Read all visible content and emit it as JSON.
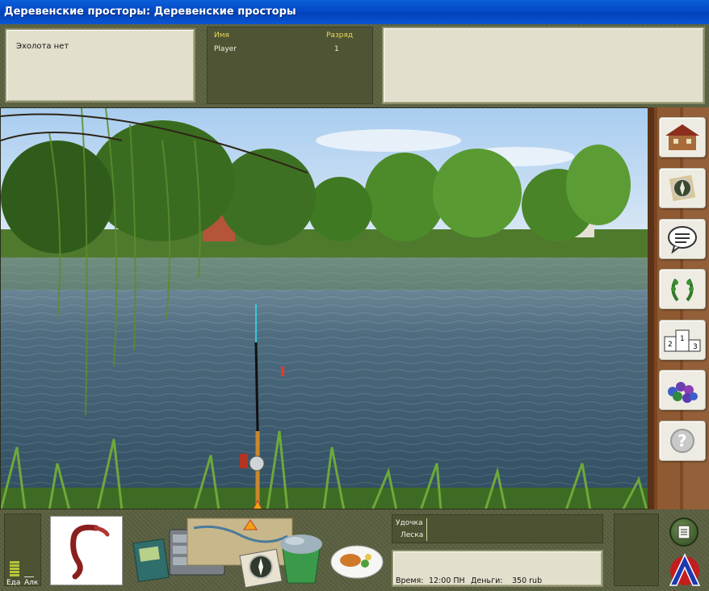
{
  "window": {
    "title": "Деревенские просторы: Деревенские просторы"
  },
  "echo_sounder": {
    "text": "Эхолота нет"
  },
  "players": {
    "headers": {
      "name": "Имя",
      "rank": "Разряд"
    },
    "rows": [
      {
        "name": "Player",
        "rank": "1"
      }
    ]
  },
  "sidebar": {
    "buttons": [
      {
        "icon": "house-icon"
      },
      {
        "icon": "compass-icon"
      },
      {
        "icon": "chat-icon"
      },
      {
        "icon": "laurel-wreath-icon"
      },
      {
        "icon": "podium-icon",
        "labels": [
          "1",
          "2",
          "3"
        ]
      },
      {
        "icon": "grapes-icon"
      },
      {
        "icon": "help-icon",
        "label": "?"
      }
    ]
  },
  "meters": {
    "food_label": "Еда",
    "alcohol_label": "Алк",
    "food_level": 0.6,
    "alcohol_level": 0
  },
  "tackle": {
    "rod_label": "Удочка",
    "line_label": "Леска"
  },
  "status": {
    "time_label": "Время:",
    "time_value": "12:00 ПН",
    "money_label": "Деньги:",
    "money_value": "350 rub"
  },
  "colors": {
    "title_bar": "#0449c7",
    "panel": "#5b6240",
    "panel_beige": "#e2e0cc",
    "header_text": "#e8d95a"
  }
}
